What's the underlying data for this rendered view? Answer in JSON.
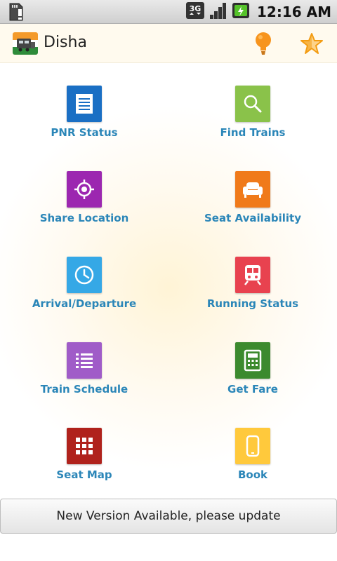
{
  "status_bar": {
    "network": "3G",
    "time": "12:16 AM",
    "icons": [
      "sd-card-alert-icon",
      "3g-icon",
      "signal-icon",
      "battery-charging-icon"
    ]
  },
  "action_bar": {
    "title": "Disha",
    "icons": [
      "train-logo-icon",
      "lightbulb-icon",
      "star-icon"
    ]
  },
  "menu": [
    {
      "label": "PNR Status",
      "icon": "document-list-icon",
      "color": "#1a6fc4"
    },
    {
      "label": "Find Trains",
      "icon": "search-icon",
      "color": "#8ac24a"
    },
    {
      "label": "Share Location",
      "icon": "location-target-icon",
      "color": "#9c27b0"
    },
    {
      "label": "Seat Availability",
      "icon": "sofa-icon",
      "color": "#f07a1a"
    },
    {
      "label": "Arrival/Departure",
      "icon": "clock-icon",
      "color": "#35a8e6"
    },
    {
      "label": "Running Status",
      "icon": "train-icon",
      "color": "#e8424f"
    },
    {
      "label": "Train Schedule",
      "icon": "list-icon",
      "color": "#a05cc8"
    },
    {
      "label": "Get Fare",
      "icon": "calculator-icon",
      "color": "#3c8a2e"
    },
    {
      "label": "Seat Map",
      "icon": "grid-icon",
      "color": "#b0221c"
    },
    {
      "label": "Book",
      "icon": "smartphone-icon",
      "color": "#ffc93c"
    }
  ],
  "update_bar": {
    "text": "New Version Available, please update"
  }
}
